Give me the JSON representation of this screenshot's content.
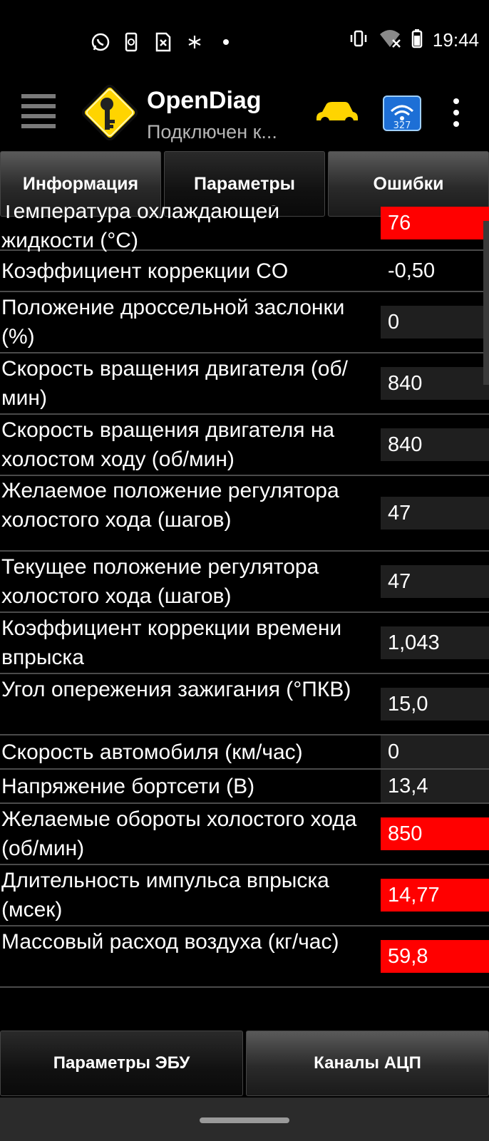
{
  "status_bar": {
    "time": "19:44",
    "left_icons": [
      "whatsapp-icon",
      "phone-sync-icon",
      "sim-card-icon",
      "sparkle-icon",
      "dot-icon"
    ],
    "right_icons": [
      "vibrate-icon",
      "wifi-off-icon",
      "battery-icon"
    ]
  },
  "app_bar": {
    "title": "OpenDiag",
    "subtitle": "Подключен к...",
    "accent_color": "#ffd400"
  },
  "tabs": [
    {
      "label": "Информация",
      "active": false
    },
    {
      "label": "Параметры",
      "active": true
    },
    {
      "label": "Ошибки",
      "active": false
    }
  ],
  "parameters": [
    {
      "label": "Температура охлаждающей жидкости (°C)",
      "value": "76",
      "state": "alarm"
    },
    {
      "label": "Коэффициент коррекции CO",
      "value": "-0,50",
      "state": "plain"
    },
    {
      "label": "Положение дроссельной заслонки (%)",
      "value": "0",
      "state": "normal"
    },
    {
      "label": "Скорость вращения двигателя (об/мин)",
      "value": "840",
      "state": "normal"
    },
    {
      "label": "Скорость вращения двигателя на холостом ходу (об/мин)",
      "value": "840",
      "state": "normal"
    },
    {
      "label": "Желаемое положение регулятора холостого хода (шагов)",
      "value": "47",
      "state": "normal"
    },
    {
      "label": "Текущее положение регулятора холостого хода (шагов)",
      "value": "47",
      "state": "normal"
    },
    {
      "label": "Коэффициент коррекции времени впрыска",
      "value": "1,043",
      "state": "normal"
    },
    {
      "label": "Угол опережения зажигания (°ПКВ)",
      "value": "15,0",
      "state": "normal"
    },
    {
      "label": "Скорость автомобиля (км/час)",
      "value": "0",
      "state": "normal"
    },
    {
      "label": "Напряжение бортсети (В)",
      "value": "13,4",
      "state": "normal"
    },
    {
      "label": "Желаемые обороты холостого хода (об/мин)",
      "value": "850",
      "state": "alarm"
    },
    {
      "label": "Длительность импульса впрыска (мсек)",
      "value": "14,77",
      "state": "alarm"
    },
    {
      "label": "Массовый расход воздуха (кг/час)",
      "value": "59,8",
      "state": "alarm"
    }
  ],
  "bottom_tabs": [
    {
      "label": "Параметры ЭБУ",
      "active": true
    },
    {
      "label": "Каналы АЦП",
      "active": false
    }
  ],
  "colors": {
    "alarm": "#ff0000",
    "value_bg": "#1f1f1f",
    "divider": "#4a4a4a"
  }
}
